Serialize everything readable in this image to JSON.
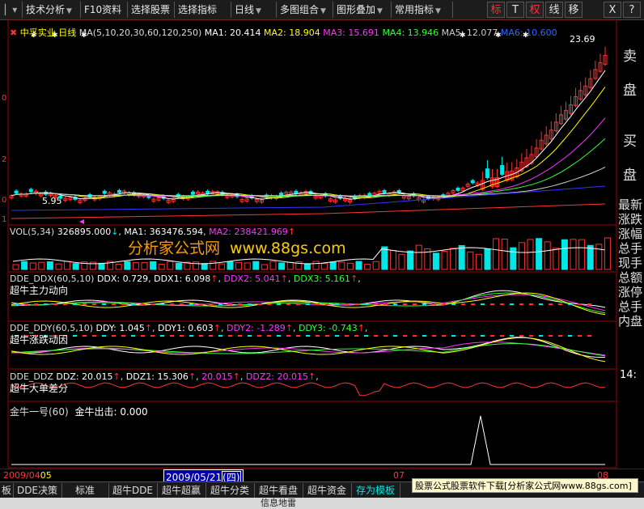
{
  "toolbar": {
    "items": [
      "技术分析",
      "F10资料",
      "选择股票",
      "选择指标",
      "日线",
      "多图组合",
      "图形叠加",
      "常用指标"
    ],
    "right_buttons": [
      "标",
      "T",
      "权",
      "线",
      "移",
      "X",
      "?"
    ]
  },
  "main_panel": {
    "stock_name": "中孚实业",
    "period": "日线",
    "ma_params": "MA(5,10,20,30,60,120,250)",
    "ma1": "MA1: 20.414",
    "ma2": "MA2: 18.904",
    "ma3": "MA3: 15.691",
    "ma4": "MA4: 13.946",
    "ma5": "MA5: 12.077",
    "ma6": "MA6: 10.600",
    "high_label": "23.69",
    "low_label": "5.95",
    "y_marks": [
      "0",
      "2",
      "0",
      "1"
    ]
  },
  "vol_panel": {
    "title": "VOL(5,34)",
    "value": "326895.000",
    "ma1": "MA1: 363476.594",
    "ma2": "MA2: 238421.969"
  },
  "ddx_panel": {
    "title": "DDE_DDX(60,5,10)",
    "ddx": "DDX: 0.729",
    "ddx1": "DDX1: 6.098",
    "ddx2": "DDX2: 5.041",
    "ddx3": "DDX3: 5.161",
    "subtitle": "超牛主力动向"
  },
  "ddy_panel": {
    "title": "DDE_DDY(60,5,10)",
    "ddy": "DDY: 1.045",
    "ddy1": "DDY1: 0.603",
    "ddy2": "DDY2: -1.289",
    "ddy3": "DDY3: -0.743",
    "subtitle": "超牛涨跌动因"
  },
  "ddz_panel": {
    "title": "DDE_DDZ",
    "ddz": "DDZ: 20.015",
    "ddz1": "DDZ1: 15.306",
    "ddz_b": "20.015",
    "ddz2": "DDZ2: 20.015",
    "subtitle": "超牛大单差分"
  },
  "jinniu_panel": {
    "title": "金牛一号(60)",
    "signal": "金牛出击: 0.000"
  },
  "side_panel": {
    "buy_sell": [
      "卖",
      "盘",
      "买",
      "盘"
    ],
    "fields": [
      "最新",
      "涨跌",
      "涨幅",
      "总手",
      "现手",
      "总额",
      "涨停",
      "总手",
      "内盘"
    ],
    "time": "14:"
  },
  "dates": {
    "start": "2009/04",
    "start_day": "05",
    "cursor": "2009/05/21",
    "cursor_weekday": "(四)",
    "mid": "07",
    "end": "08"
  },
  "tabs": [
    "板",
    "DDE决策",
    "标准",
    "超牛DDE",
    "超牛超赢",
    "超牛分类",
    "超牛看盘",
    "超牛资金",
    "存为模板"
  ],
  "banner": "股票公式股票软件下载[分析家公式网www.88gs.com]",
  "watermark": {
    "text": "分析家公式网",
    "url": "www.88gs.com"
  },
  "status": "信息地雷",
  "colors": {
    "up": "#ff3030",
    "down": "#00e5e5",
    "ma5": "#ffffff",
    "ma10": "#ffff00",
    "ma20": "#ff33ff",
    "ma30": "#33ff33",
    "ma60": "#cccccc",
    "ma120": "#3333ff",
    "ma250": "#ff3333"
  }
}
